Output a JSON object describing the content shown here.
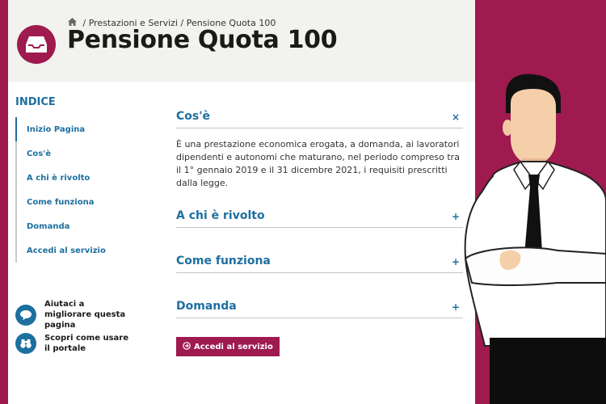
{
  "header": {
    "breadcrumb": [
      "Prestazioni e Servizi",
      "Pensione Quota 100"
    ],
    "breadcrumb_separator": "/",
    "title": "Pensione Quota 100"
  },
  "index": {
    "title": "INDICE",
    "items": [
      {
        "label": "Inizio Pagina",
        "active": true
      },
      {
        "label": "Cos'è",
        "active": false
      },
      {
        "label": "A chi è rivolto",
        "active": false
      },
      {
        "label": "Come funziona",
        "active": false
      },
      {
        "label": "Domanda",
        "active": false
      },
      {
        "label": "Accedi al servizio",
        "active": false
      }
    ]
  },
  "help_links": [
    {
      "label": "Aiutaci a migliorare questa pagina",
      "icon": "chat-bubble-icon"
    },
    {
      "label": "Scopri come usare il portale",
      "icon": "binoculars-icon"
    }
  ],
  "accordion": [
    {
      "title": "Cos'è",
      "expanded": true,
      "toggle": "×",
      "content": "È una prestazione economica erogata, a domanda, ai lavoratori dipendenti e autonomi che maturano, nel periodo compreso tra il 1° gennaio 2019 e il 31 dicembre 2021, i requisiti prescritti dalla legge."
    },
    {
      "title": "A chi è rivolto",
      "expanded": false,
      "toggle": "+"
    },
    {
      "title": "Come funziona",
      "expanded": false,
      "toggle": "+"
    },
    {
      "title": "Domanda",
      "expanded": false,
      "toggle": "+"
    }
  ],
  "service_button": {
    "label": "Accedi al servizio",
    "icon": "arrow-circle-icon"
  },
  "colors": {
    "brand": "#9e1a4f",
    "accent_blue": "#1d6fa0",
    "header_bg": "#f2f2ee"
  }
}
